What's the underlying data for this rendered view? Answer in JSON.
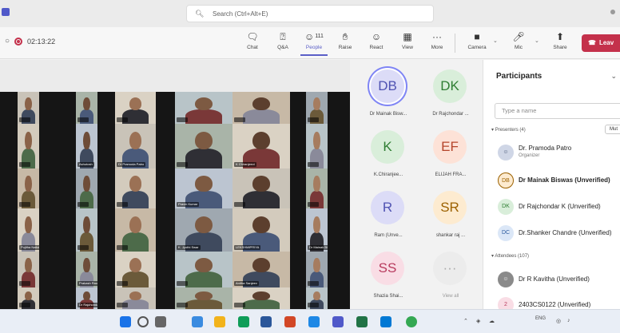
{
  "titlebar": {
    "search_icon": "search-icon",
    "search_placeholder": "Search (Ctrl+Alt+E)"
  },
  "toolbar": {
    "timer": "02:13:22",
    "buttons": [
      {
        "label": "Chat",
        "icon": "chat-icon"
      },
      {
        "label": "Q&A",
        "icon": "qa-icon"
      },
      {
        "label": "People",
        "icon": "people-icon",
        "count": "111"
      },
      {
        "label": "Raise",
        "icon": "raise-hand-icon"
      },
      {
        "label": "React",
        "icon": "react-icon"
      },
      {
        "label": "View",
        "icon": "view-icon"
      },
      {
        "label": "More",
        "icon": "more-icon"
      },
      {
        "label": "Camera",
        "icon": "camera-icon"
      },
      {
        "label": "Mic",
        "icon": "mic-icon"
      },
      {
        "label": "Share",
        "icon": "share-icon"
      }
    ],
    "leave_label": "Leav",
    "accent": "#5b5fc7",
    "leave_color": "#c4314b"
  },
  "video_tiles": [
    {
      "label": ""
    },
    {
      "label": ""
    },
    {
      "label": ""
    },
    {
      "label": ""
    },
    {
      "label": ""
    },
    {
      "label": ""
    },
    {
      "label": ""
    },
    {
      "label": "Ashutosh"
    },
    {
      "label": "Dr Pramoda Patro"
    },
    {
      "label": ""
    },
    {
      "label": "K Chiranjeevi"
    },
    {
      "label": ""
    },
    {
      "label": ""
    },
    {
      "label": ""
    },
    {
      "label": ""
    },
    {
      "label": "Pravin Kumar"
    },
    {
      "label": ""
    },
    {
      "label": ""
    },
    {
      "label": "Pujitha Nallabothula"
    },
    {
      "label": ""
    },
    {
      "label": ""
    },
    {
      "label": "K. Jyothi Swar"
    },
    {
      "label": "LEKSHMIPRIYA"
    },
    {
      "label": "Dr Mainak Biswas"
    },
    {
      "label": ""
    },
    {
      "label": "Prakash Rao Kamal"
    },
    {
      "label": ""
    },
    {
      "label": ""
    },
    {
      "label": "Anitha Sanjeev"
    },
    {
      "label": ""
    },
    {
      "label": ""
    },
    {
      "label": "Dr Rajchondar"
    },
    {
      "label": ""
    },
    {
      "label": ""
    },
    {
      "label": ""
    },
    {
      "label": ""
    },
    {
      "label": ""
    },
    {
      "label": ""
    },
    {
      "label": "Ramesh Kum"
    },
    {
      "label": ""
    }
  ],
  "gallery": [
    {
      "initials": "DB",
      "name": "Dr Mainak Bisw...",
      "bg": "#dcdcf7",
      "fg": "#4f52b2",
      "speaking": true
    },
    {
      "initials": "DK",
      "name": "Dr Rajchondar ...",
      "bg": "#d9eeda",
      "fg": "#2e7d32"
    },
    {
      "initials": "K",
      "name": "K.Chiranjee...",
      "bg": "#d9eeda",
      "fg": "#2e7d32"
    },
    {
      "initials": "EF",
      "name": "ELIJAH FRA...",
      "bg": "#fde2d7",
      "fg": "#b5452b"
    },
    {
      "initials": "R",
      "name": "Ram (Unve...",
      "bg": "#dcdcf7",
      "fg": "#4f52b2"
    },
    {
      "initials": "SR",
      "name": "shankar raj ...",
      "bg": "#fdebd0",
      "fg": "#9c6100"
    },
    {
      "initials": "SS",
      "name": "Shazia Shai...",
      "bg": "#f9dde5",
      "fg": "#b83b5e"
    },
    {
      "initials": "",
      "name": "View all",
      "bg": "#ececec",
      "fg": "#aaaaaa"
    }
  ],
  "panel": {
    "title": "Participants",
    "search_placeholder": "Type a name",
    "presenters_label": "Presenters (4)",
    "mute_label": "Mut",
    "attendees_label": "Attendees (107)",
    "presenters": [
      {
        "initials": "",
        "name": "Dr. Pramoda Patro",
        "sub": "Organizer",
        "bg": "#cfd6e6",
        "fg": "#3a4a6b"
      },
      {
        "initials": "DB",
        "name": "Dr Mainak Biswas (Unverified)",
        "bg": "#fdebd0",
        "fg": "#9c6100"
      },
      {
        "initials": "DK",
        "name": "Dr Rajchondar K (Unverified)",
        "bg": "#d9eeda",
        "fg": "#2e7d32"
      },
      {
        "initials": "DC",
        "name": "Dr.Shanker Chandre (Unverified)",
        "bg": "#dbe7f7",
        "fg": "#2b5a9e"
      }
    ],
    "attendees": [
      {
        "initials": "",
        "name": "Dr R Kavitha (Unverified)",
        "bg": "#8a8a8a",
        "fg": "#ffffff"
      },
      {
        "initials": "2",
        "name": "2403CS0122 (Unverified)",
        "bg": "#f9dde5",
        "fg": "#b83b5e",
        "extra": "C"
      }
    ]
  },
  "taskbar": {
    "tray_lang": "ENG"
  }
}
